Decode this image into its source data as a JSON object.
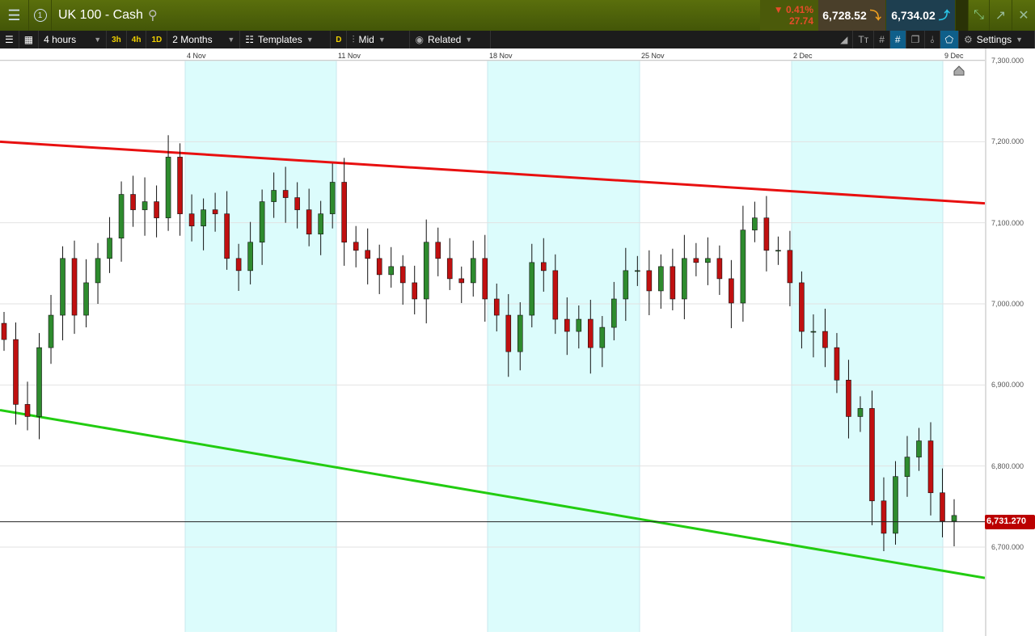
{
  "header": {
    "title": "UK 100 - Cash",
    "badge": "1",
    "change_pct": "0.41%",
    "change_pts": "27.74",
    "sell": "6,728.52",
    "buy": "6,734.02"
  },
  "toolbar": {
    "interval": "4 hours",
    "quick": [
      "3h",
      "4h",
      "1D"
    ],
    "range": "2 Months",
    "templates": "Templates",
    "d": "D",
    "price_type": "Mid",
    "related": "Related",
    "settings": "Settings"
  },
  "chart_data": {
    "type": "candlestick",
    "instrument": "UK 100 - Cash",
    "interval": "4 hours",
    "x_labels": [
      "4 Nov",
      "11 Nov",
      "18 Nov",
      "25 Nov",
      "2 Dec",
      "9 Dec"
    ],
    "y_ticks": [
      "7,300.000",
      "7,200.000",
      "7,100.000",
      "7,000.000",
      "6,900.000",
      "6,800.000",
      "6,700.000"
    ],
    "y_tick_values": [
      7300,
      7200,
      7100,
      7000,
      6900,
      6800,
      6700
    ],
    "ylim": [
      6600,
      7300
    ],
    "current_price": 6731.27,
    "current_price_label": "6,731.270",
    "closes": [
      6956,
      6876,
      6861,
      6946,
      6986,
      7056,
      6986,
      7026,
      7056,
      7081,
      7135,
      7116,
      7126,
      7106,
      7181,
      7111,
      7096,
      7116,
      7111,
      7056,
      7041,
      7076,
      7126,
      7140,
      7131,
      7116,
      7086,
      7111,
      7150,
      7076,
      7066,
      7056,
      7036,
      7046,
      7026,
      7006,
      7076,
      7056,
      7031,
      7026,
      7056,
      7006,
      6986,
      6941,
      6986,
      7051,
      7041,
      6981,
      6966,
      6981,
      6946,
      6971,
      7006,
      7041,
      7041,
      7016,
      7046,
      7006,
      7056,
      7051,
      7056,
      7031,
      7001,
      7091,
      7106,
      7066,
      7066,
      7026,
      6966,
      6966,
      6946,
      6906,
      6861,
      6871,
      6757,
      6717,
      6787,
      6811,
      6831,
      6767,
      6732,
      6739
    ],
    "trendlines": [
      {
        "name": "resistance",
        "color": "#e81010",
        "start": 7200,
        "end": 7124
      },
      {
        "name": "support",
        "color": "#22cc11",
        "start": 6869,
        "end": 6662
      }
    ],
    "colors": {
      "up": "#2e8b2e",
      "down": "#c01010",
      "week_shade": "#dcfcfc"
    }
  }
}
